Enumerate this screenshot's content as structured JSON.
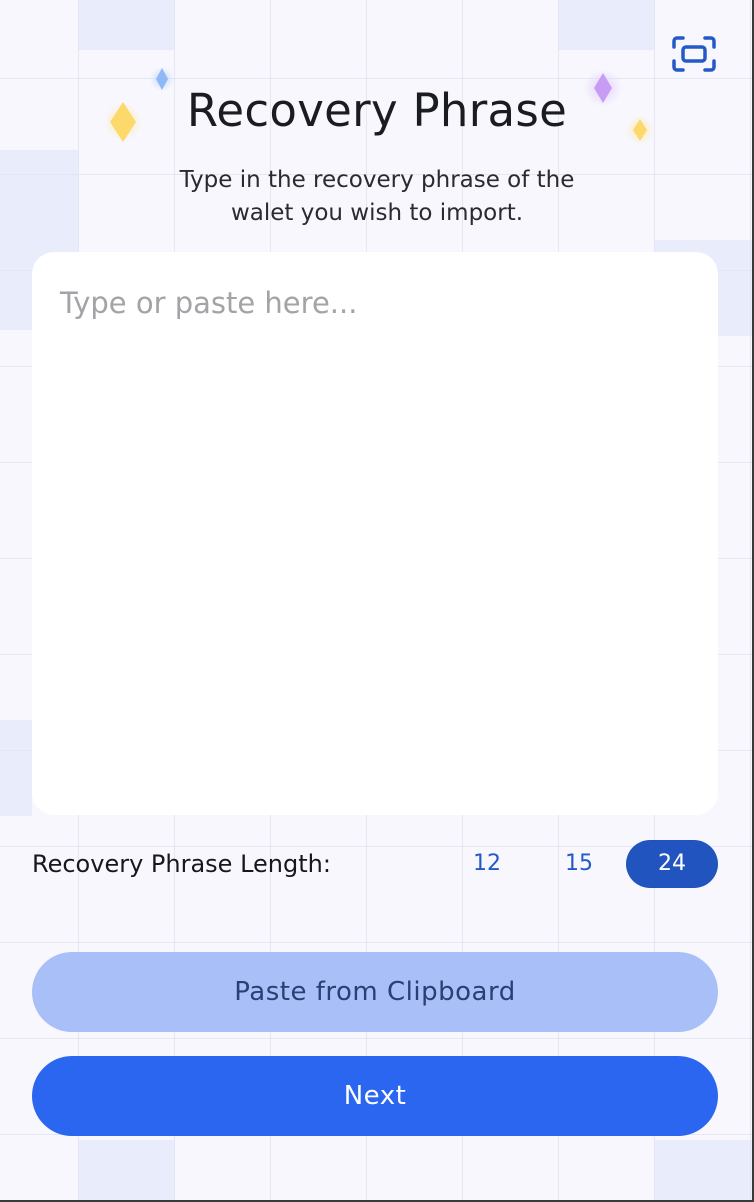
{
  "header": {
    "title": "Recovery Phrase",
    "subtitle": "Type in the recovery phrase of the walet you wish to import.",
    "scan_icon": "scan-frame-icon"
  },
  "phrase_input": {
    "value": "",
    "placeholder": "Type or paste here..."
  },
  "length_selector": {
    "label": "Recovery Phrase Length:",
    "options": [
      "12",
      "15",
      "24"
    ],
    "selected": "24"
  },
  "actions": {
    "paste_label": "Paste from Clipboard",
    "next_label": "Next"
  },
  "colors": {
    "accent": "#2b66f0",
    "selected_pill": "#2254bf",
    "paste_button": "#a9bff7",
    "background": "#f7f7fd",
    "sparkle_yellow": "#fcd96a",
    "sparkle_purple": "#c79cf5",
    "sparkle_blue": "#8fb8f7"
  },
  "icons": {
    "sparkles": [
      "diamond-sparkle-icon"
    ]
  }
}
